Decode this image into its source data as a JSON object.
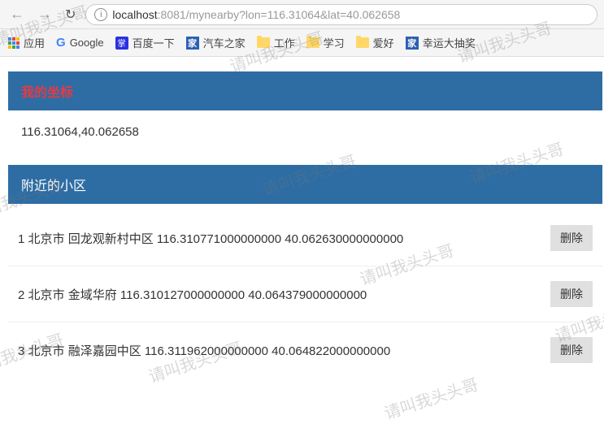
{
  "browser": {
    "url_host": "localhost",
    "url_path": ":8081/mynearby?lon=116.31064&lat=40.062658"
  },
  "bookmarks": {
    "apps": "应用",
    "google": "Google",
    "baidu": "百度一下",
    "autohome": "汽车之家",
    "work": "工作",
    "study": "学习",
    "hobby": "爱好",
    "lottery": "幸运大抽奖"
  },
  "sections": {
    "coord_title": "我的坐标",
    "coord_value": "116.31064,40.062658",
    "nearby_title": "附近的小区"
  },
  "nearby": [
    {
      "idx": "1",
      "city": "北京市",
      "name": "回龙观新村中区",
      "lon": "116.310771000000000",
      "lat": "40.062630000000000"
    },
    {
      "idx": "2",
      "city": "北京市",
      "name": "金域华府",
      "lon": "116.310127000000000",
      "lat": "40.064379000000000"
    },
    {
      "idx": "3",
      "city": "北京市",
      "name": "融泽嘉园中区",
      "lon": "116.311962000000000",
      "lat": "40.064822000000000"
    }
  ],
  "buttons": {
    "delete": "删除"
  },
  "watermark": "请叫我头头哥"
}
